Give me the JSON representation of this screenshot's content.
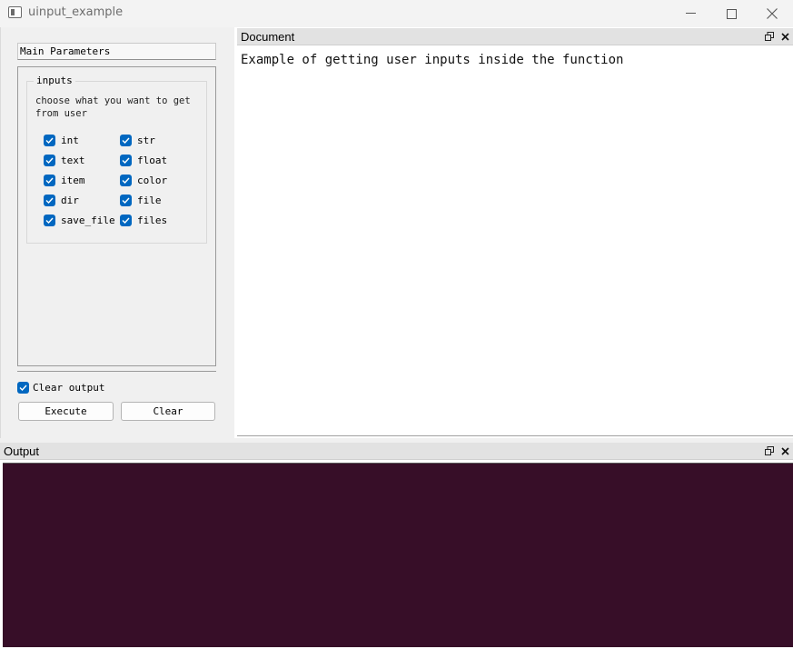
{
  "window": {
    "title": "uinput_example"
  },
  "sidebar": {
    "main_parameters_label": "Main Parameters",
    "group": {
      "title": "inputs",
      "description": "choose what you want to get from user",
      "options": [
        {
          "label": "int",
          "checked": true
        },
        {
          "label": "str",
          "checked": true
        },
        {
          "label": "text",
          "checked": true
        },
        {
          "label": "float",
          "checked": true
        },
        {
          "label": "item",
          "checked": true
        },
        {
          "label": "color",
          "checked": true
        },
        {
          "label": "dir",
          "checked": true
        },
        {
          "label": "file",
          "checked": true
        },
        {
          "label": "save_file",
          "checked": true
        },
        {
          "label": "files",
          "checked": true
        }
      ]
    },
    "clear_output": {
      "label": "Clear output",
      "checked": true
    },
    "execute_label": "Execute",
    "clear_label": "Clear"
  },
  "document": {
    "title": "Document",
    "content": "Example of getting user inputs inside the function"
  },
  "output": {
    "title": "Output",
    "background_color": "#370e28"
  },
  "colors": {
    "checkbox_accent": "#0067c0"
  },
  "icons": [
    "app-icon",
    "minimize-icon",
    "maximize-icon",
    "close-icon",
    "float-icon",
    "dock-close-icon",
    "check-icon"
  ]
}
